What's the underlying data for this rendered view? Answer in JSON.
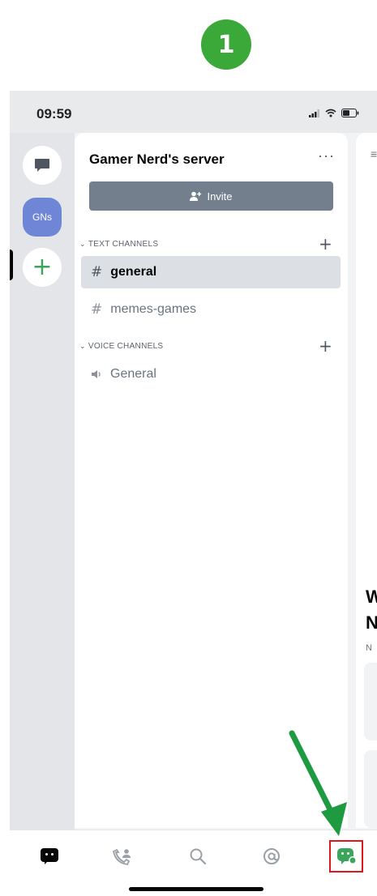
{
  "step_badge": "1",
  "status_bar": {
    "time": "09:59"
  },
  "rail": {
    "server_initials": "GNs",
    "add_server_symbol": "+"
  },
  "server": {
    "name": "Gamer Nerd's server",
    "more_symbol": "···",
    "invite_label": "Invite"
  },
  "categories": {
    "text": {
      "label": "TEXT CHANNELS",
      "add_symbol": "+"
    },
    "voice": {
      "label": "VOICE CHANNELS",
      "add_symbol": "+"
    }
  },
  "channels": {
    "general": {
      "name": "general",
      "symbol": "#"
    },
    "memes": {
      "name": "memes-games",
      "symbol": "#"
    },
    "voice_general": {
      "name": "General"
    }
  },
  "peek": {
    "menu_symbol": "≡",
    "w": "W",
    "n": "N",
    "sub": "N"
  },
  "bottom_nav": {
    "items": [
      "home-icon",
      "friends-icon",
      "search-icon",
      "mentions-icon",
      "profile-icon"
    ],
    "highlighted": "profile-icon"
  },
  "colors": {
    "accent_green": "#3ba83a",
    "server_blue": "#6f86d6",
    "invite_gray": "#747f8d",
    "highlight_red": "#e0161a",
    "arrow_green": "#1e9a40"
  }
}
